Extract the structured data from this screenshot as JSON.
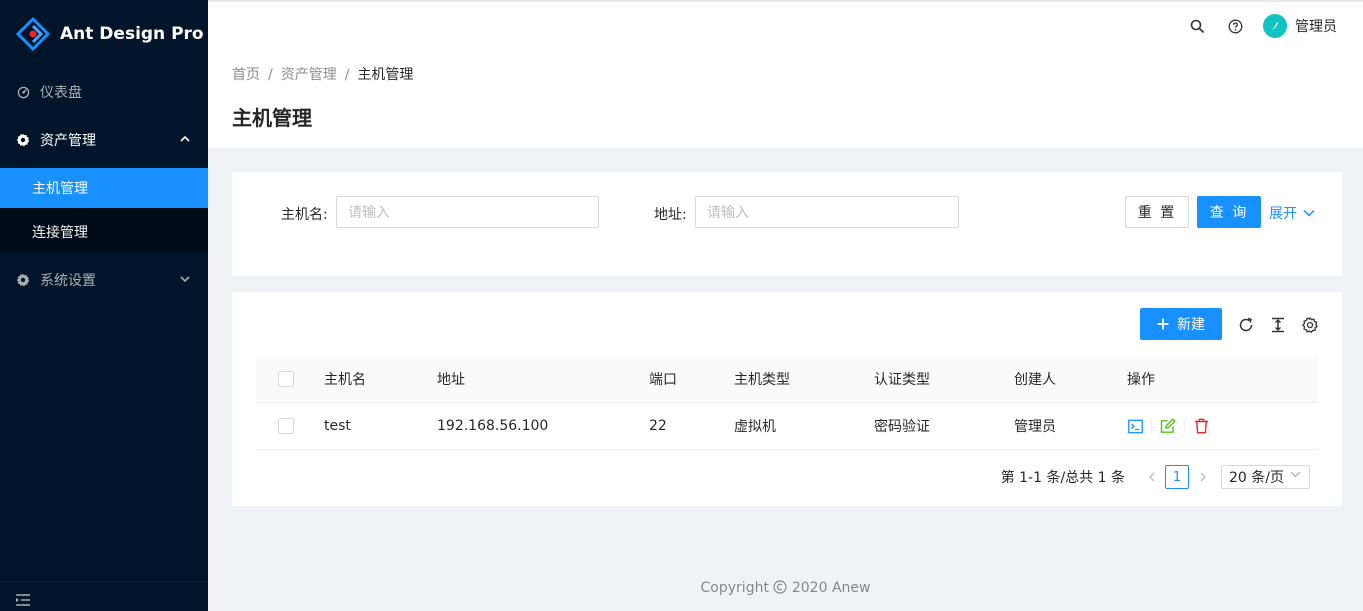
{
  "app": {
    "title": "Ant Design Pro"
  },
  "sidebar": {
    "items": [
      {
        "label": "仪表盘",
        "icon": "dashboard-icon"
      },
      {
        "label": "资产管理",
        "icon": "gear-icon",
        "expanded": true,
        "children": [
          {
            "label": "主机管理",
            "active": true
          },
          {
            "label": "连接管理"
          }
        ]
      },
      {
        "label": "系统设置",
        "icon": "gear-icon",
        "expanded": false
      }
    ]
  },
  "header": {
    "user_name": "管理员",
    "icons": [
      "search-icon",
      "question-icon"
    ]
  },
  "breadcrumb": [
    "首页",
    "资产管理",
    "主机管理"
  ],
  "page_title": "主机管理",
  "search_form": {
    "host_label": "主机名:",
    "host_placeholder": "请输入",
    "addr_label": "地址:",
    "addr_placeholder": "请输入",
    "reset_label": "重 置",
    "query_label": "查 询",
    "expand_label": "展开"
  },
  "toolbar": {
    "new_label": "新建",
    "icons": [
      "reload-icon",
      "column-height-icon",
      "setting-icon"
    ]
  },
  "table": {
    "columns": [
      "主机名",
      "地址",
      "端口",
      "主机类型",
      "认证类型",
      "创建人",
      "操作"
    ],
    "rows": [
      {
        "name": "test",
        "address": "192.168.56.100",
        "port": "22",
        "host_type": "虚拟机",
        "auth_type": "密码验证",
        "creator": "管理员",
        "actions": [
          "terminal-icon",
          "edit-icon",
          "delete-icon"
        ]
      }
    ]
  },
  "pagination": {
    "total_text": "第 1-1 条/总共 1 条",
    "current_page": "1",
    "page_size": "20 条/页"
  },
  "footer": {
    "copyright": "Copyright",
    "text": "2020 Anew"
  },
  "colors": {
    "primary": "#1890ff",
    "sider_bg": "#001529",
    "submenu_bg": "#000c17",
    "terminal": "#1890ff",
    "edit": "#52c41a",
    "delete": "#f5222d"
  }
}
